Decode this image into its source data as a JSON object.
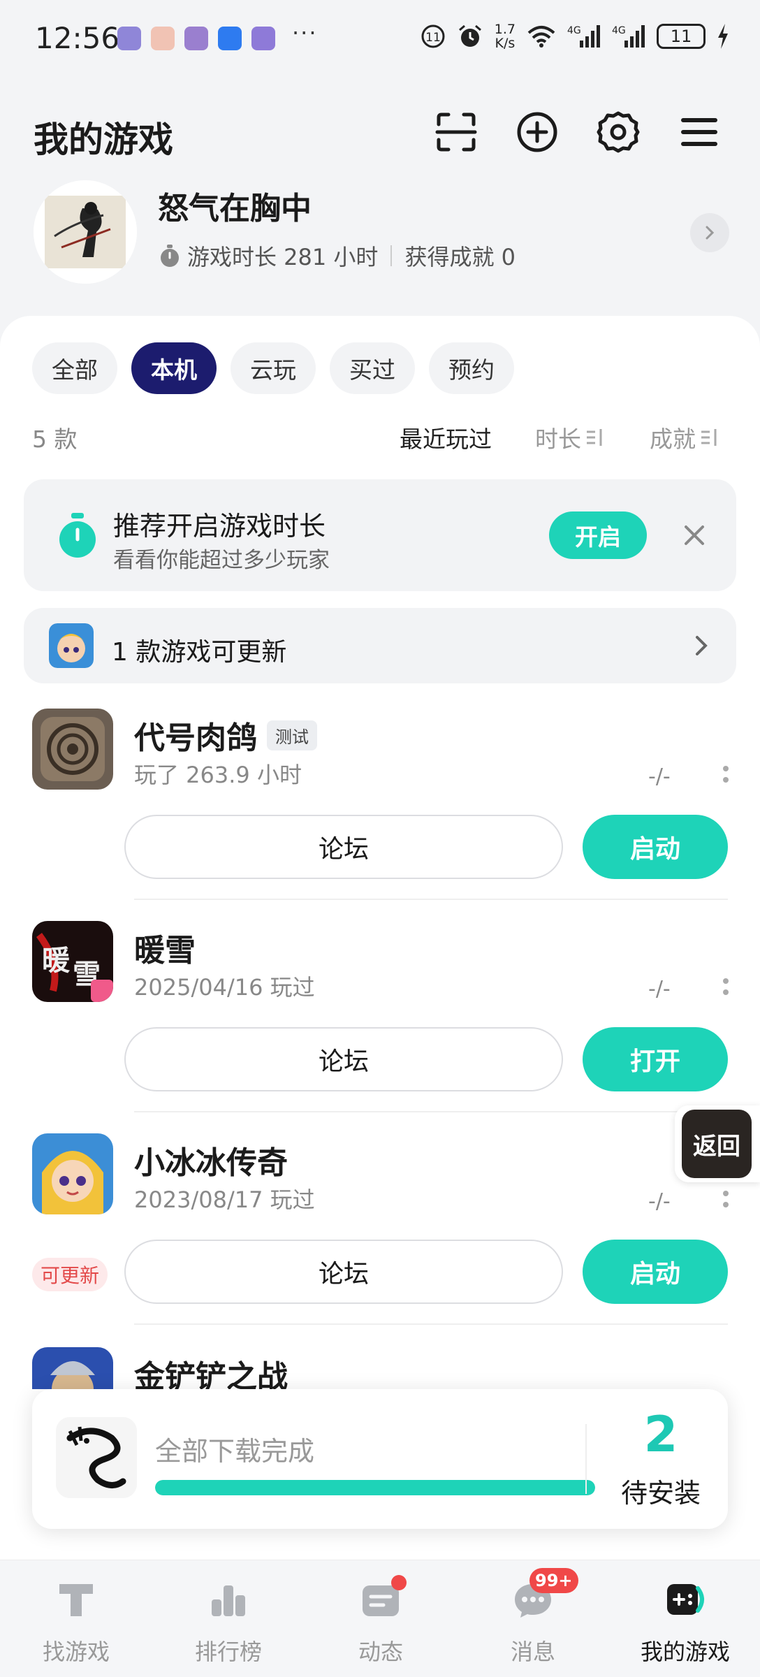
{
  "status_bar": {
    "time": "12:56",
    "more": "···",
    "net_speed_value": "1.7",
    "net_speed_unit": "K/s",
    "battery": "11"
  },
  "header": {
    "title": "我的游戏",
    "icons": [
      "scan-icon",
      "add-circle-icon",
      "settings-icon",
      "menu-icon"
    ]
  },
  "profile": {
    "username": "怒气在胸中",
    "play_time": "游戏时长 281 小时",
    "achievements": "获得成就 0"
  },
  "tabs": [
    {
      "label": "全部",
      "active": false
    },
    {
      "label": "本机",
      "active": true
    },
    {
      "label": "云玩",
      "active": false
    },
    {
      "label": "买过",
      "active": false
    },
    {
      "label": "预约",
      "active": false
    }
  ],
  "list_meta": {
    "count": "5 款",
    "sort_recent": "最近玩过",
    "sort_time": "时长",
    "sort_achieve": "成就"
  },
  "recommend": {
    "title": "推荐开启游戏时长",
    "subtitle": "看看你能超过多少玩家",
    "button": "开启"
  },
  "update_row": {
    "text": "1 款游戏可更新"
  },
  "games": [
    {
      "name": "代号肉鸽",
      "tag": "测试",
      "sub": "玩了 263.9 小时",
      "rank": "-/-",
      "forum": "论坛",
      "action": "启动",
      "update_tag": ""
    },
    {
      "name": "暖雪",
      "tag": "",
      "sub": "2025/04/16 玩过",
      "rank": "-/-",
      "forum": "论坛",
      "action": "打开",
      "update_tag": ""
    },
    {
      "name": "小冰冰传奇",
      "tag": "",
      "sub": "2023/08/17 玩过",
      "rank": "-/-",
      "forum": "论坛",
      "action": "启动",
      "update_tag": "可更新"
    },
    {
      "name": "金铲铲之战",
      "tag": "",
      "sub": "",
      "rank": "",
      "forum": "",
      "action": "",
      "update_tag": ""
    }
  ],
  "float_back": {
    "label": "返回"
  },
  "download": {
    "text": "全部下载完成",
    "progress": 1.0,
    "count": "2",
    "label": "待安装"
  },
  "bottom_nav": [
    {
      "label": "找游戏",
      "active": false
    },
    {
      "label": "排行榜",
      "active": false
    },
    {
      "label": "动态",
      "active": false
    },
    {
      "label": "消息",
      "active": false,
      "badge": "99+"
    },
    {
      "label": "我的游戏",
      "active": true
    }
  ],
  "colors": {
    "accent": "#1ed3b8",
    "tab_active": "#1c1c6e",
    "badge": "#f04848"
  }
}
